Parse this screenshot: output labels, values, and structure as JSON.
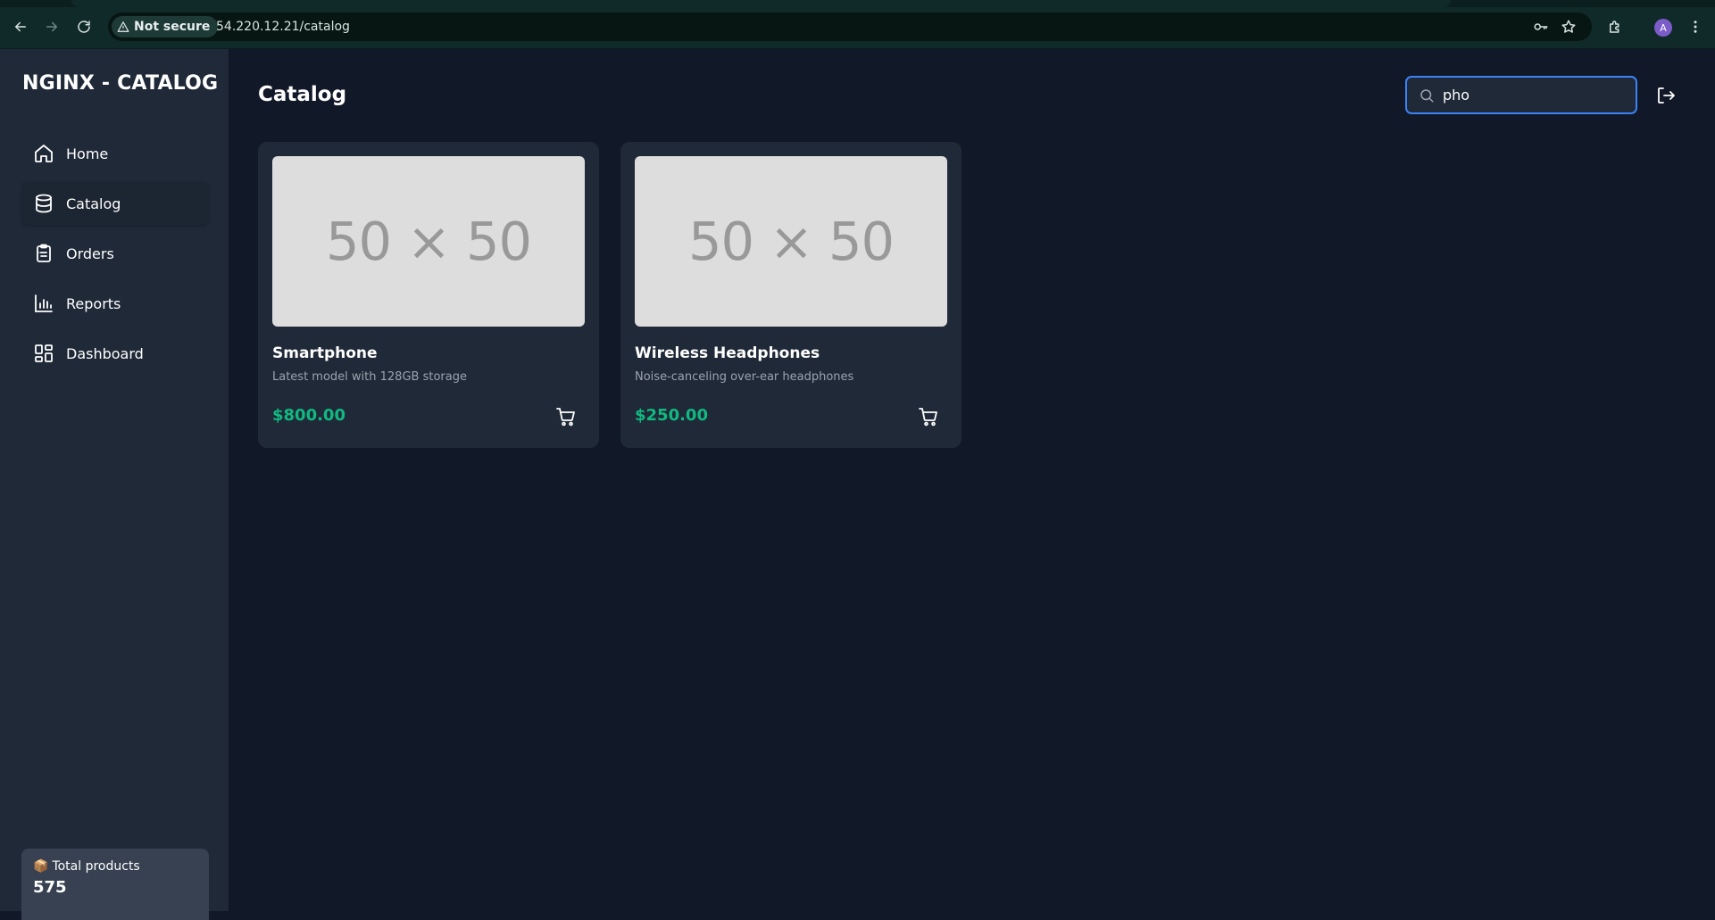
{
  "browser": {
    "security_label": "Not secure",
    "url": "54.220.12.21/catalog",
    "profile_initial": "A"
  },
  "sidebar": {
    "brand": "NGINX - CATALOG",
    "items": [
      {
        "label": "Home",
        "icon": "home-icon"
      },
      {
        "label": "Catalog",
        "icon": "database-icon",
        "active": true
      },
      {
        "label": "Orders",
        "icon": "clipboard-icon"
      },
      {
        "label": "Reports",
        "icon": "bar-chart-icon"
      },
      {
        "label": "Dashboard",
        "icon": "dashboard-icon"
      }
    ],
    "stats": {
      "icon": "📦",
      "label": "Total products",
      "value": "575"
    }
  },
  "main": {
    "title": "Catalog",
    "search": {
      "value": "pho",
      "placeholder": ""
    },
    "products": [
      {
        "image_text": "50 × 50",
        "name": "Smartphone",
        "description": "Latest model with 128GB storage",
        "price": "$800.00"
      },
      {
        "image_text": "50 × 50",
        "name": "Wireless Headphones",
        "description": "Noise-canceling over-ear headphones",
        "price": "$250.00"
      }
    ]
  },
  "colors": {
    "background": "#111827",
    "sidebar": "#1f2937",
    "card": "#1f2937",
    "price": "#10b981",
    "focus_ring": "#3b82f6"
  }
}
